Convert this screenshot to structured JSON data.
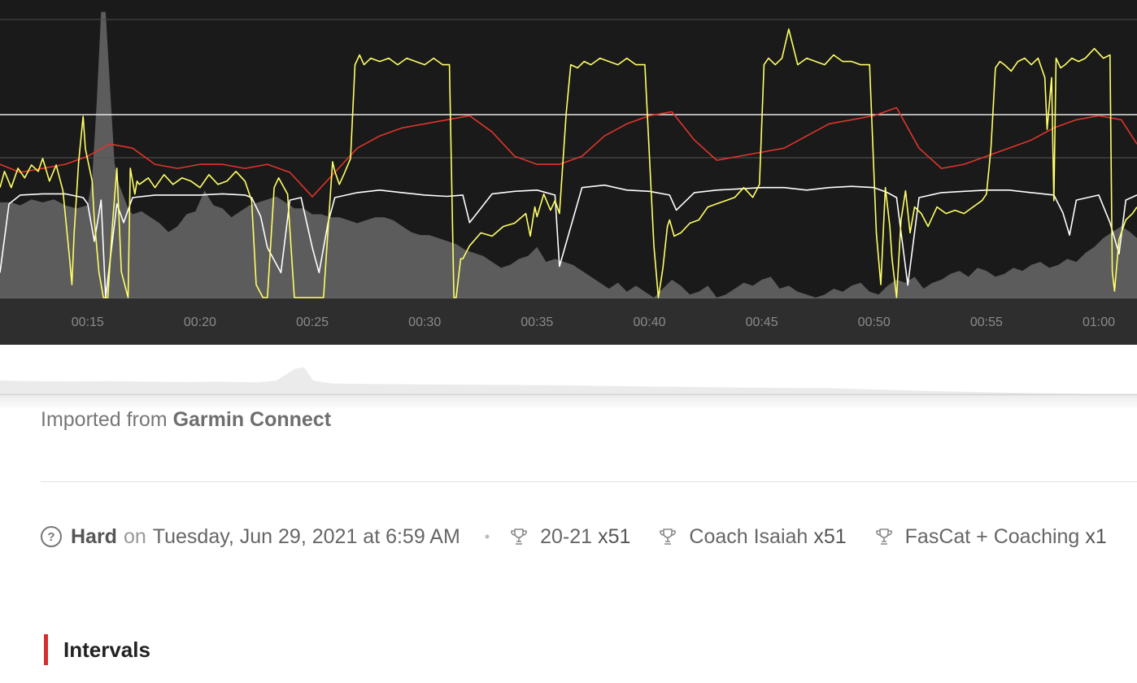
{
  "source": {
    "prefix": "Imported from",
    "name": "Garmin Connect"
  },
  "meta": {
    "help_icon": "question-circle-icon",
    "difficulty": "Hard",
    "on_word": "on",
    "date": "Tuesday, Jun 29, 2021 at 6:59 AM",
    "separator": "•",
    "tags": [
      {
        "icon": "trophy-icon",
        "name": "20-21",
        "count": "x51"
      },
      {
        "icon": "trophy-icon",
        "name": "Coach Isaiah",
        "count": "x51"
      },
      {
        "icon": "trophy-icon",
        "name": "FasCat + Coaching",
        "count": "x1"
      }
    ]
  },
  "section": {
    "title": "Intervals"
  },
  "colors": {
    "chart_bg": "#1a1a1a",
    "axis_band": "#2e2e2e",
    "elevation_fill": "#5c5c5c",
    "power": "#ffff66",
    "heart_rate": "#e0352b",
    "cadence": "#ffffff",
    "accent": "#d3302f"
  },
  "chart_data": {
    "type": "line",
    "x_ticks": [
      "00:15",
      "00:20",
      "00:25",
      "00:30",
      "00:35",
      "00:40",
      "00:45",
      "00:50",
      "00:55",
      "01:00"
    ],
    "x_tick_minutes": [
      15,
      20,
      25,
      30,
      35,
      40,
      45,
      50,
      55,
      60
    ],
    "x_range_minutes": [
      11.1,
      61.7
    ],
    "series": [
      {
        "key": "power",
        "x_minutes": [
          11.1,
          11.3,
          11.6,
          11.9,
          12.2,
          12.5,
          12.8,
          13.0,
          13.3,
          13.6,
          13.9,
          14.2,
          14.3,
          14.4,
          14.6,
          14.8,
          14.9,
          15.2,
          15.3,
          15.5,
          15.7,
          15.9,
          16.1,
          16.3,
          16.5,
          16.8,
          16.9,
          17.1,
          17.2,
          17.3,
          17.7,
          18.0,
          18.4,
          18.8,
          19.2,
          19.6,
          20.0,
          20.4,
          20.8,
          21.2,
          21.6,
          22.0,
          22.3,
          22.5,
          22.8,
          23.0,
          23.3,
          23.5,
          23.9,
          24.2,
          24.5,
          24.6,
          25.2,
          25.5,
          25.9,
          26.0,
          26.2,
          26.4,
          26.7,
          26.9,
          27.1,
          27.3,
          27.6,
          28.0,
          28.4,
          28.8,
          29.2,
          29.6,
          30.0,
          30.4,
          30.8,
          31.1,
          31.3,
          31.4,
          31.6,
          31.7,
          32.0,
          32.5,
          33.0,
          33.5,
          34.0,
          34.5,
          34.7,
          34.9,
          35.0,
          35.3,
          35.6,
          35.8,
          36.0,
          36.3,
          36.5,
          36.8,
          37.1,
          37.4,
          37.8,
          38.2,
          38.6,
          39.0,
          39.4,
          39.8,
          40.2,
          40.4,
          40.6,
          40.8,
          40.9,
          41.1,
          41.4,
          41.8,
          42.2,
          42.6,
          43.0,
          43.4,
          43.8,
          44.2,
          44.6,
          44.9,
          45.1,
          45.3,
          45.6,
          45.9,
          46.2,
          46.6,
          47.0,
          47.4,
          47.8,
          48.2,
          48.6,
          49.0,
          49.4,
          49.8,
          50.1,
          50.3,
          50.5,
          50.7,
          50.8,
          51.0,
          51.2,
          51.4,
          51.6,
          51.8,
          52.1,
          52.4,
          52.8,
          53.2,
          53.6,
          54.0,
          54.4,
          54.8,
          55.0,
          55.2,
          55.4,
          55.6,
          55.8,
          56.1,
          56.4,
          56.7,
          57.0,
          57.3,
          57.6,
          57.7,
          57.9,
          58.0,
          58.1,
          58.3,
          58.5,
          58.8,
          59.1,
          59.4,
          59.8,
          60.2,
          60.5,
          60.6,
          60.7,
          60.9,
          61.2,
          61.5,
          61.7
        ],
        "y_watts": [
          170,
          195,
          170,
          200,
          185,
          205,
          195,
          215,
          180,
          205,
          165,
          60,
          20,
          100,
          210,
          280,
          230,
          180,
          120,
          40,
          0,
          0,
          110,
          200,
          40,
          0,
          200,
          160,
          180,
          175,
          185,
          170,
          190,
          175,
          185,
          180,
          170,
          190,
          175,
          180,
          195,
          180,
          150,
          20,
          0,
          0,
          170,
          185,
          160,
          0,
          0,
          0,
          0,
          0,
          210,
          195,
          175,
          190,
          215,
          360,
          375,
          360,
          370,
          365,
          370,
          360,
          370,
          365,
          360,
          370,
          360,
          360,
          0,
          0,
          60,
          60,
          80,
          100,
          95,
          110,
          115,
          130,
          95,
          140,
          125,
          160,
          135,
          150,
          130,
          285,
          360,
          355,
          365,
          360,
          370,
          365,
          360,
          370,
          360,
          360,
          80,
          0,
          45,
          110,
          120,
          95,
          100,
          115,
          120,
          140,
          145,
          150,
          155,
          170,
          155,
          175,
          360,
          370,
          360,
          370,
          415,
          360,
          370,
          365,
          360,
          375,
          365,
          365,
          360,
          360,
          100,
          20,
          170,
          110,
          60,
          0,
          120,
          165,
          100,
          140,
          130,
          110,
          140,
          130,
          135,
          130,
          140,
          150,
          160,
          230,
          355,
          365,
          360,
          350,
          365,
          370,
          360,
          370,
          340,
          260,
          340,
          150,
          370,
          355,
          360,
          370,
          365,
          370,
          385,
          370,
          375,
          40,
          10,
          90,
          120,
          130,
          140
        ],
        "y_max": 460
      },
      {
        "key": "heart_rate",
        "x_minutes": [
          11.1,
          12.0,
          13.0,
          14.0,
          15.0,
          16.0,
          17.0,
          18.0,
          19.0,
          20.0,
          21.0,
          22.0,
          23.0,
          24.0,
          25.0,
          26.0,
          27.0,
          28.0,
          29.0,
          30.0,
          31.0,
          32.0,
          33.0,
          34.0,
          35.0,
          36.0,
          37.0,
          38.0,
          39.0,
          40.0,
          41.0,
          42.0,
          43.0,
          44.0,
          45.0,
          46.0,
          47.0,
          48.0,
          49.0,
          50.0,
          51.0,
          52.0,
          53.0,
          54.0,
          55.0,
          56.0,
          57.0,
          58.0,
          59.0,
          60.0,
          61.0,
          61.7
        ],
        "y": [
          148,
          146,
          147,
          148,
          150,
          153,
          152,
          148,
          147,
          148,
          148,
          147,
          148,
          146,
          140,
          146,
          152,
          155,
          157,
          158,
          159,
          160,
          156,
          150,
          148,
          148,
          150,
          155,
          158,
          160,
          161,
          154,
          149,
          150,
          151,
          152,
          155,
          158,
          159,
          160,
          162,
          152,
          147,
          148,
          150,
          152,
          154,
          157,
          159,
          160,
          159,
          153
        ],
        "y_range": [
          100,
          200
        ]
      },
      {
        "key": "cadence",
        "x_minutes": [
          11.1,
          11.5,
          12.0,
          13.0,
          14.0,
          14.8,
          15.0,
          15.3,
          15.6,
          15.8,
          16.3,
          16.6,
          17.0,
          18.0,
          19.0,
          20.0,
          21.0,
          22.0,
          22.3,
          22.7,
          23.0,
          23.6,
          24.0,
          24.5,
          25.0,
          25.3,
          25.7,
          26.0,
          27.0,
          28.0,
          29.0,
          30.0,
          31.0,
          31.7,
          32.0,
          33.0,
          34.0,
          35.0,
          35.8,
          36.0,
          37.0,
          38.0,
          39.0,
          40.0,
          40.9,
          41.2,
          42.0,
          43.0,
          44.0,
          45.0,
          46.0,
          47.0,
          48.0,
          49.0,
          50.0,
          50.6,
          51.0,
          51.5,
          52.0,
          53.0,
          54.0,
          55.0,
          56.0,
          57.0,
          58.0,
          58.4,
          58.7,
          59.0,
          60.0,
          60.5,
          60.9,
          61.2,
          61.7
        ],
        "y_rpm": [
          20,
          75,
          82,
          83,
          83,
          80,
          75,
          45,
          78,
          0,
          75,
          60,
          80,
          82,
          82,
          82,
          83,
          82,
          80,
          65,
          40,
          20,
          78,
          80,
          40,
          20,
          60,
          80,
          84,
          86,
          84,
          82,
          81,
          82,
          60,
          83,
          85,
          86,
          82,
          25,
          88,
          90,
          86,
          85,
          82,
          70,
          84,
          86,
          87,
          88,
          88,
          86,
          88,
          89,
          88,
          84,
          80,
          10,
          80,
          84,
          85,
          86,
          86,
          84,
          82,
          68,
          50,
          78,
          82,
          60,
          35,
          78,
          82
        ],
        "y_range": [
          0,
          200
        ]
      },
      {
        "key": "elevation",
        "x_minutes": [
          11.1,
          11.6,
          12.0,
          12.5,
          13.0,
          13.5,
          14.0,
          14.5,
          15.0,
          15.2,
          15.4,
          15.6,
          15.8,
          16.0,
          16.2,
          16.4,
          16.6,
          16.8,
          17.0,
          17.4,
          17.8,
          18.2,
          18.6,
          19.0,
          19.4,
          19.8,
          20.2,
          20.6,
          21.0,
          21.4,
          21.8,
          22.2,
          22.6,
          23.0,
          23.4,
          23.8,
          24.2,
          24.6,
          25.0,
          25.4,
          25.8,
          26.2,
          26.6,
          27.0,
          27.4,
          27.8,
          28.2,
          28.6,
          29.0,
          29.4,
          29.8,
          30.2,
          30.6,
          31.0,
          31.4,
          31.8,
          32.2,
          32.6,
          33.0,
          33.4,
          33.8,
          34.2,
          34.6,
          35.0,
          35.4,
          35.8,
          36.2,
          36.6,
          37.0,
          37.4,
          37.8,
          38.2,
          38.6,
          39.0,
          39.4,
          39.8,
          40.2,
          40.6,
          41.0,
          41.4,
          41.8,
          42.2,
          42.6,
          43.0,
          43.4,
          43.8,
          44.2,
          44.6,
          45.0,
          45.4,
          45.8,
          46.2,
          46.6,
          47.0,
          47.4,
          47.8,
          48.2,
          48.6,
          49.0,
          49.4,
          49.8,
          50.2,
          50.6,
          51.0,
          51.4,
          51.8,
          52.2,
          52.6,
          53.0,
          53.4,
          53.8,
          54.2,
          54.6,
          55.0,
          55.4,
          55.8,
          56.2,
          56.6,
          57.0,
          57.4,
          57.8,
          58.2,
          58.6,
          59.0,
          59.4,
          59.8,
          60.2,
          60.6,
          61.0,
          61.4,
          61.7
        ],
        "y_pct": [
          32,
          32,
          31,
          33,
          32,
          33,
          31,
          30,
          31,
          40,
          65,
          96,
          96,
          70,
          45,
          38,
          34,
          30,
          28,
          29,
          27,
          25,
          22,
          24,
          28,
          29,
          36,
          31,
          30,
          27,
          29,
          31,
          32,
          33,
          34,
          32,
          30,
          30,
          28,
          28,
          27,
          27,
          26,
          25,
          26,
          27,
          27,
          26,
          24,
          22,
          21,
          21,
          20,
          19,
          18,
          16,
          15,
          14,
          12,
          10,
          11,
          13,
          14,
          17,
          12,
          13,
          12,
          11,
          9,
          7,
          5,
          3,
          5,
          2,
          4,
          2,
          0,
          3,
          6,
          4,
          1,
          2,
          4,
          0,
          1,
          3,
          5,
          4,
          6,
          7,
          3,
          4,
          2,
          1,
          0,
          1,
          3,
          2,
          4,
          5,
          2,
          1,
          4,
          6,
          5,
          7,
          3,
          5,
          6,
          8,
          9,
          7,
          10,
          9,
          7,
          8,
          10,
          9,
          11,
          12,
          10,
          11,
          13,
          12,
          15,
          17,
          20,
          22,
          24,
          22,
          20,
          18
        ],
        "y_range": [
          0,
          100
        ]
      }
    ],
    "overview": {
      "type": "area",
      "x_minutes": [
        0,
        2,
        4,
        6,
        8,
        10,
        12,
        14,
        15,
        15.5,
        16,
        16.5,
        17,
        18,
        20,
        25,
        30,
        35,
        40,
        45,
        50,
        55,
        60,
        61.7
      ],
      "y_pct": [
        50,
        48,
        47,
        48,
        46,
        45,
        46,
        44,
        50,
        70,
        90,
        95,
        50,
        40,
        38,
        36,
        34,
        30,
        26,
        24,
        15,
        8,
        3,
        3
      ]
    }
  }
}
